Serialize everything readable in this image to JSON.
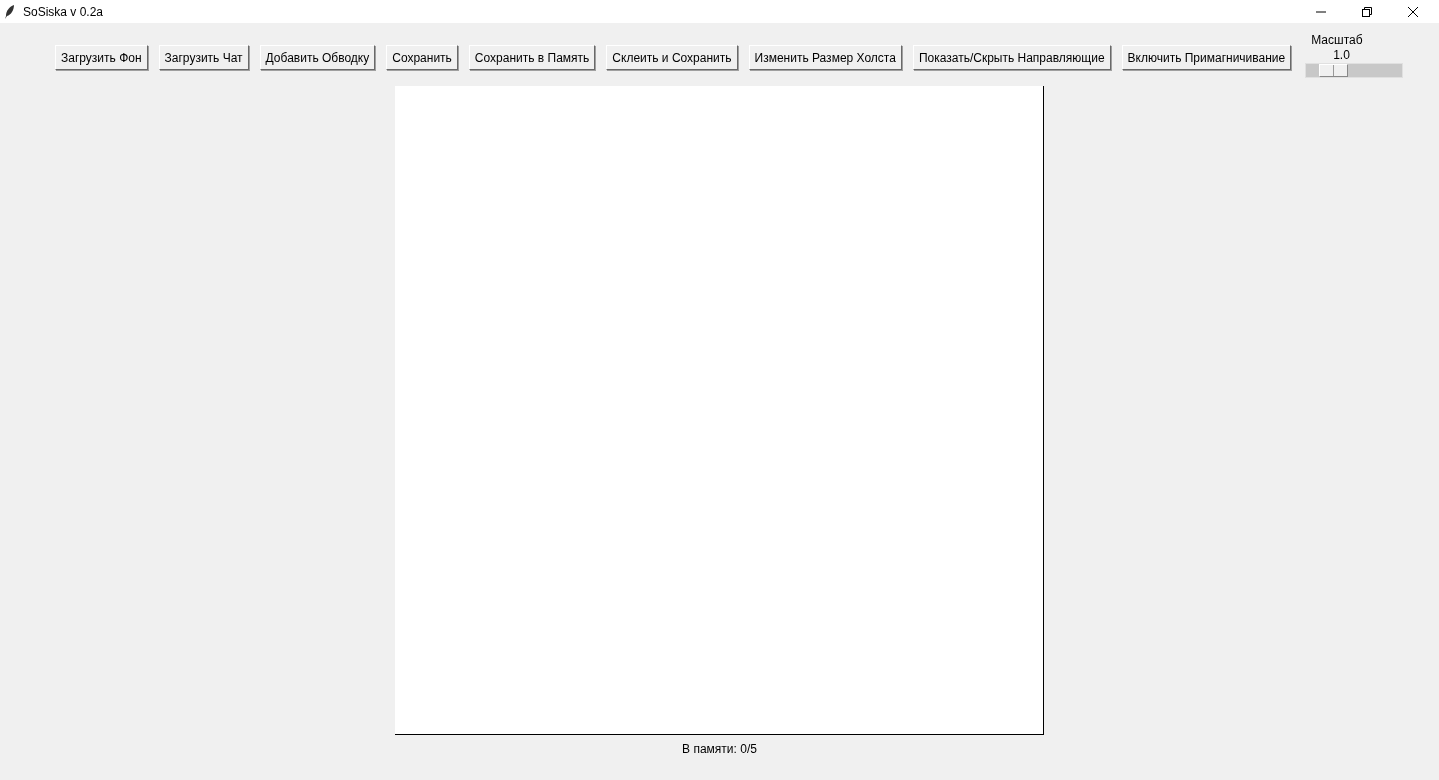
{
  "window": {
    "title": "SoSiska v 0.2a"
  },
  "toolbar": {
    "buttons": [
      "Загрузить Фон",
      "Загрузить Чат",
      "Добавить Обводку",
      "Сохранить",
      "Сохранить в Память",
      "Склеить и Сохранить",
      "Изменить Размер Холста",
      "Показать/Скрыть Направляющие",
      "Включить Примагничивание"
    ]
  },
  "scale": {
    "label": "Масштаб",
    "reading": "1.0",
    "level": 0.19
  },
  "status": "В памяти: 0/5"
}
